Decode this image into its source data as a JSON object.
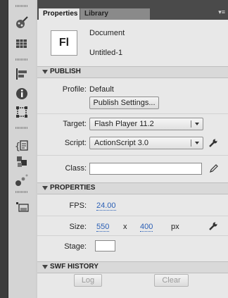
{
  "tabs": {
    "properties": "Properties",
    "library": "Library",
    "menu": "▾≡"
  },
  "document": {
    "icon_text": "Fl",
    "type_label": "Document",
    "name": "Untitled-1"
  },
  "publish": {
    "title": "PUBLISH",
    "profile_label": "Profile:",
    "profile_value": "Default",
    "settings_button": "Publish Settings...",
    "target_label": "Target:",
    "target_value": "Flash Player 11.2",
    "script_label": "Script:",
    "script_value": "ActionScript 3.0",
    "class_label": "Class:",
    "class_value": ""
  },
  "properties": {
    "title": "PROPERTIES",
    "fps_label": "FPS:",
    "fps_value": "24.00",
    "size_label": "Size:",
    "width": "550",
    "x_sep": "x",
    "height": "400",
    "unit": "px",
    "stage_label": "Stage:",
    "stage_color": "#ffffff"
  },
  "swf_history": {
    "title": "SWF HISTORY",
    "log_button": "Log",
    "clear_button": "Clear"
  },
  "icons": [
    "brush-icon",
    "grid-icon",
    "align-icon",
    "info-icon",
    "transform-icon",
    "code-snippets-icon",
    "components-icon",
    "motion-presets-icon",
    "scene-icon",
    "wrench-icon",
    "pencil-icon"
  ]
}
